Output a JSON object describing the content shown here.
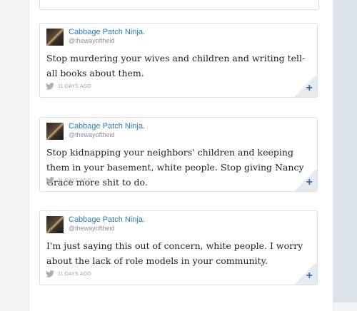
{
  "tweets": [
    {
      "author": "Cabbage Patch Ninja.",
      "handle": "@thewayoftheid",
      "text": "Stop murdering your wives and children and writing tell-all books about them.",
      "time": "11 DAYS AGO"
    },
    {
      "author": "Cabbage Patch Ninja.",
      "handle": "@thewayoftheid",
      "text": "Stop kidnapping your neighbors' children and keeping them in your basement, white people. Stop giving Nancy Grace more shit to do.",
      "time": "11 DAYS AGO"
    },
    {
      "author": "Cabbage Patch Ninja.",
      "handle": "@thewayoftheid",
      "text": "I'm just saying this out of concern, white people. I worry about the lack of role models in your community.",
      "time": "11 DAYS AGO"
    }
  ],
  "icons": {
    "source": "twitter-bird-icon",
    "expand": "plus-icon",
    "expand_glyph": "+"
  },
  "colors": {
    "link": "#2b7bb9",
    "accent": "#3a6ea8"
  }
}
